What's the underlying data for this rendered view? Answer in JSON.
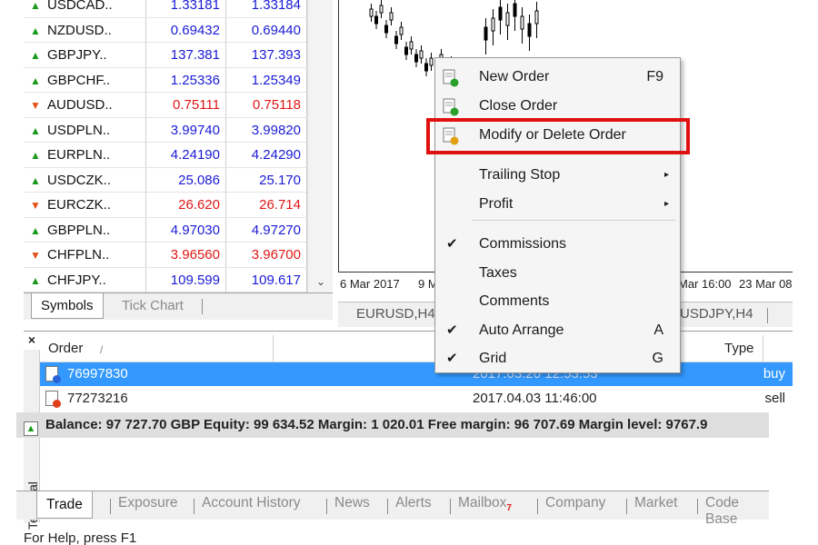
{
  "market_watch": {
    "rows": [
      {
        "symbol": "USDCAD..",
        "dir": "up",
        "bid": "1.33181",
        "ask": "1.33184"
      },
      {
        "symbol": "NZDUSD..",
        "dir": "up",
        "bid": "0.69432",
        "ask": "0.69440"
      },
      {
        "symbol": "GBPJPY..",
        "dir": "up",
        "bid": "137.381",
        "ask": "137.393"
      },
      {
        "symbol": "GBPCHF..",
        "dir": "up",
        "bid": "1.25336",
        "ask": "1.25349"
      },
      {
        "symbol": "AUDUSD..",
        "dir": "dn",
        "bid": "0.75111",
        "ask": "0.75118"
      },
      {
        "symbol": "USDPLN..",
        "dir": "up",
        "bid": "3.99740",
        "ask": "3.99820"
      },
      {
        "symbol": "EURPLN..",
        "dir": "up",
        "bid": "4.24190",
        "ask": "4.24290"
      },
      {
        "symbol": "USDCZK..",
        "dir": "up",
        "bid": "25.086",
        "ask": "25.170"
      },
      {
        "symbol": "EURCZK..",
        "dir": "dn",
        "bid": "26.620",
        "ask": "26.714"
      },
      {
        "symbol": "GBPPLN..",
        "dir": "up",
        "bid": "4.97030",
        "ask": "4.97270"
      },
      {
        "symbol": "CHFPLN..",
        "dir": "dn",
        "bid": "3.96560",
        "ask": "3.96700"
      },
      {
        "symbol": "CHFJPY..",
        "dir": "up",
        "bid": "109.599",
        "ask": "109.617"
      }
    ],
    "tabs": [
      "Symbols",
      "Tick Chart"
    ]
  },
  "chart": {
    "x_labels": [
      "6 Mar 2017",
      "9 M",
      "Mar 16:00",
      "23 Mar 08"
    ],
    "tabs": [
      "EURUSD,H4",
      "USDJPY,H4"
    ]
  },
  "menu": {
    "items": [
      {
        "label": "New Order",
        "shortcut": "F9",
        "icon": "new-order-icon"
      },
      {
        "label": "Close Order",
        "shortcut": "",
        "icon": "close-order-icon"
      },
      {
        "label": "Modify or Delete Order",
        "shortcut": "",
        "icon": "modify-order-icon"
      },
      {
        "label": "Trailing Stop",
        "submenu": true
      },
      {
        "label": "Profit",
        "submenu": true
      },
      {
        "label": "Commissions",
        "checked": true
      },
      {
        "label": "Taxes",
        "checked": false
      },
      {
        "label": "Comments",
        "checked": false
      },
      {
        "label": "Auto Arrange",
        "shortcut": "A",
        "checked": true
      },
      {
        "label": "Grid",
        "shortcut": "G",
        "checked": true
      }
    ],
    "check_mark": "✔",
    "submenu_arrow": "▸"
  },
  "terminal": {
    "side_label": "Terminal",
    "close": "×",
    "headers": {
      "order": "Order",
      "sort": "/",
      "type": "Type"
    },
    "orders": [
      {
        "id": "76997830",
        "time": "2017.03.20 12:53:53",
        "type": "buy",
        "selected": true
      },
      {
        "id": "77273216",
        "time": "2017.04.03 11:46:00",
        "type": "sell",
        "selected": false
      }
    ],
    "balance_line": "Balance: 97 727.70 GBP  Equity: 99 634.52  Margin: 1 020.01  Free margin: 96 707.69  Margin level: 9767.9",
    "tabs": [
      "Trade",
      "Exposure",
      "Account History",
      "News",
      "Alerts",
      "Mailbox",
      "Company",
      "Market",
      "Code Base"
    ],
    "mailbox_badge": "7"
  },
  "status_bar": "For Help, press F1",
  "colors": {
    "up_price": "#1b1bd6",
    "down_price": "#e01616",
    "selection": "#3399ff",
    "highlight_box": "#e01010"
  }
}
